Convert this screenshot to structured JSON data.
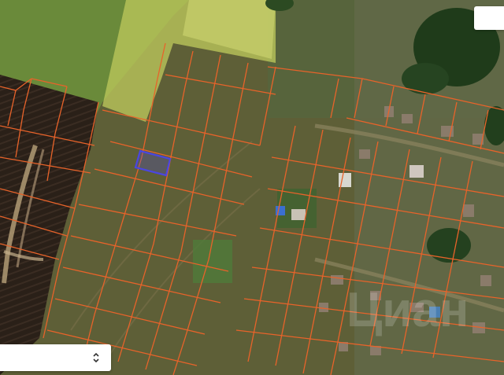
{
  "map": {
    "type": "satellite cadastral map",
    "boundary_color": "#e8632a",
    "highlight_color": "#4b46e0",
    "highlighted_parcel": "selected-plot",
    "watermark": "Циан"
  },
  "controls": {
    "top_right_button_icon": "map-control-icon",
    "layer_select_value": "",
    "layer_select_icon": "up-down-chevron-icon"
  }
}
